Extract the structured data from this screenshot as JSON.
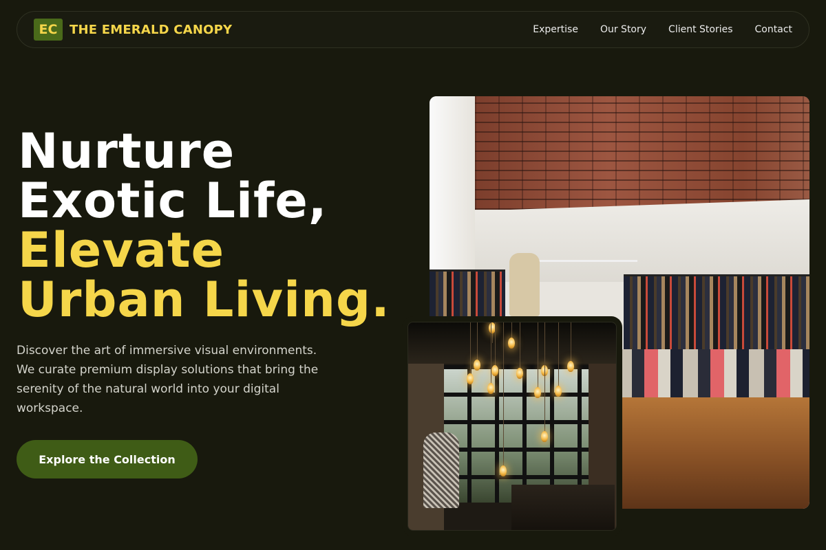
{
  "brand": {
    "logo_mark": "EC",
    "name": "THE EMERALD CANOPY"
  },
  "nav": {
    "links": [
      "Expertise",
      "Our Story",
      "Client Stories",
      "Contact"
    ]
  },
  "hero": {
    "headline_white_1": "Nurture",
    "headline_white_2": "Exotic Life,",
    "headline_yellow_1": "Elevate",
    "headline_yellow_2": "Urban Living.",
    "description": "Discover the art of immersive visual environments. We curate premium display solutions that bring the serenity of the natural world into your digital workspace.",
    "cta_label": "Explore the Collection"
  },
  "images": {
    "main": "photo-retail-store-brick-wall",
    "secondary": "photo-cafe-pendant-lights"
  },
  "colors": {
    "background": "#18190d",
    "accent_yellow": "#f5d64a",
    "accent_green": "#3f5c16",
    "text_light": "#d4d4cc"
  }
}
